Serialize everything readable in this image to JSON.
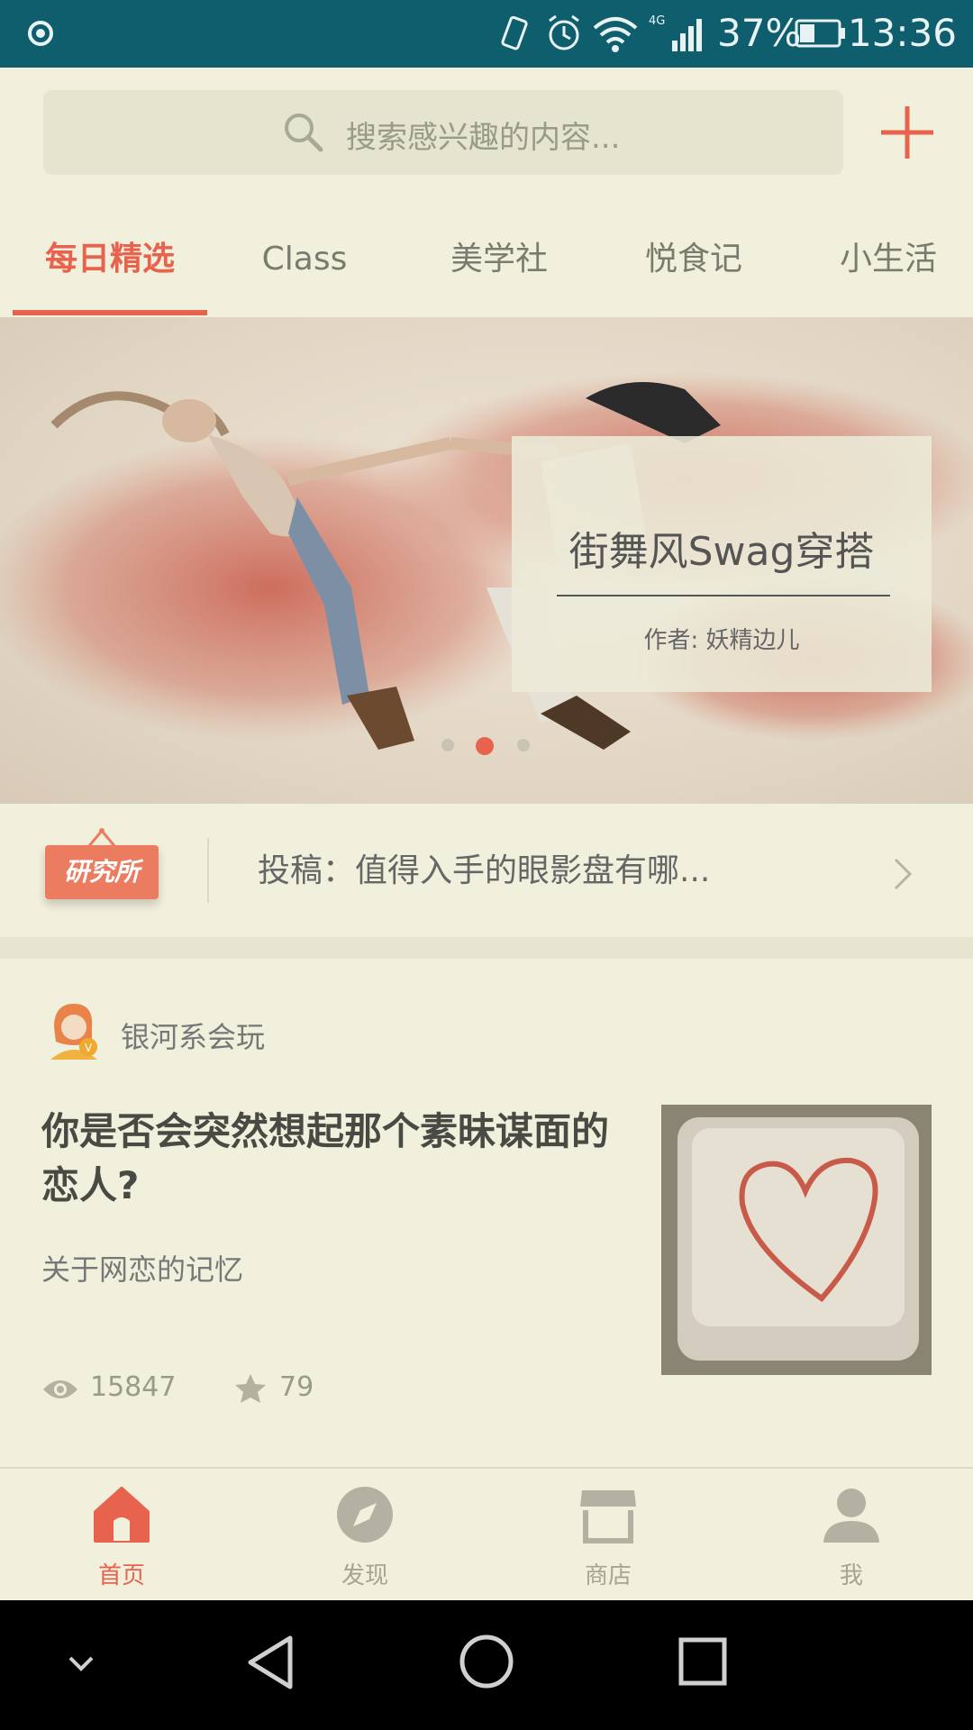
{
  "status_bar": {
    "battery": "37%",
    "time": "13:36",
    "network": "4G"
  },
  "search": {
    "placeholder": "搜索感兴趣的内容..."
  },
  "tabs": [
    {
      "label": "每日精选",
      "active": true
    },
    {
      "label": "Class",
      "active": false
    },
    {
      "label": "美学社",
      "active": false
    },
    {
      "label": "悦食记",
      "active": false
    },
    {
      "label": "小生活",
      "active": false
    }
  ],
  "banner": {
    "title": "街舞风Swag穿搭",
    "author": "作者: 妖精边儿",
    "page_count": 3,
    "active_page": 2
  },
  "notice": {
    "tag": "研究所",
    "text": "投稿：值得入手的眼影盘有哪..."
  },
  "article": {
    "author": "银河系会玩",
    "title": "你是否会突然想起那个素昧谋面的恋人?",
    "subtitle": "关于网恋的记忆",
    "views": "15847",
    "stars": "79"
  },
  "bottom_nav": [
    {
      "label": "首页",
      "icon": "home-icon",
      "active": true
    },
    {
      "label": "发现",
      "icon": "compass-icon",
      "active": false
    },
    {
      "label": "商店",
      "icon": "store-icon",
      "active": false
    },
    {
      "label": "我",
      "icon": "user-icon",
      "active": false
    }
  ],
  "colors": {
    "accent": "#e8634d",
    "status_bar": "#0f5e6e",
    "background": "#f1f0dc"
  }
}
